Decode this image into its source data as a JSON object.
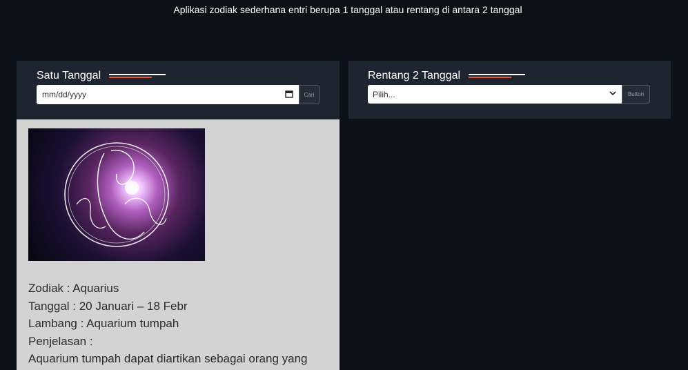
{
  "header": {
    "subtitle": "Aplikasi zodiak sederhana entri berupa 1 tanggal atau rentang di antara 2 tanggal"
  },
  "single_date": {
    "title": "Satu Tanggal",
    "placeholder": "mm/dd/yyyy",
    "button_label": "Cari"
  },
  "range": {
    "title": "Rentang 2 Tanggal",
    "select_value": "Pilih...",
    "button_label": "Button"
  },
  "result": {
    "zodiak": "Zodiak : Aquarius",
    "tanggal": "Tanggal : 20 Januari – 18 Febr",
    "lambang": "Lambang : Aquarium tumpah",
    "penjelasan_label": "Penjelasan :",
    "penjelasan_text": "Aquarium tumpah dapat diartikan sebagai orang yang"
  },
  "colors": {
    "background": "#0d1017",
    "panel": "#1f2530",
    "accent": "#e05540",
    "result_bg": "#d3d3d3"
  },
  "icons": {
    "calendar": "calendar-icon",
    "chevron": "chevron-down-icon"
  }
}
